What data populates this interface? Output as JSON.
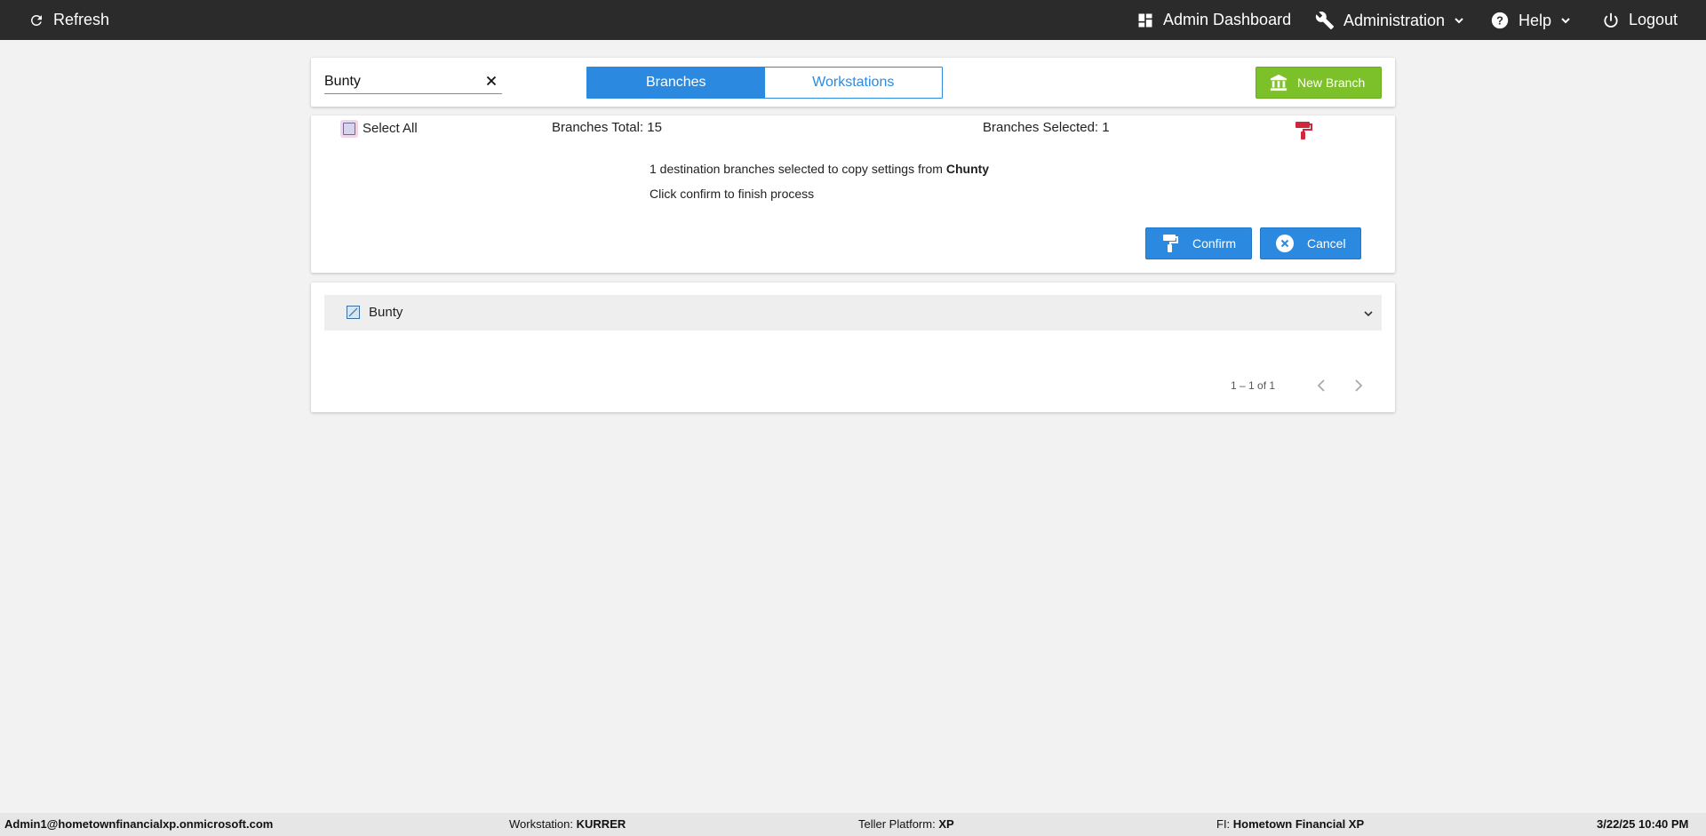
{
  "nav": {
    "refresh_label": "Refresh",
    "admin_dashboard_label": "Admin Dashboard",
    "administration_label": "Administration",
    "help_label": "Help",
    "logout_label": "Logout"
  },
  "search": {
    "value": "Bunty",
    "clear_icon": "close-icon"
  },
  "tabs": [
    {
      "label": "Branches",
      "active": true
    },
    {
      "label": "Workstations",
      "active": false
    }
  ],
  "new_branch_label": "New Branch",
  "copy_panel": {
    "select_all_label": "Select All",
    "branches_total": "Branches Total: 15",
    "branches_selected": "Branches Selected: 1",
    "message_prefix": "1 destination branches selected to copy settings from",
    "source_branch": "Chunty",
    "hint": "Click confirm to finish process",
    "confirm_label": "Confirm",
    "cancel_label": "Cancel"
  },
  "branch_list": {
    "items": [
      {
        "name": "Bunty",
        "checked": true
      }
    ],
    "paginator": "1 – 1 of 1"
  },
  "footer": {
    "user": "Admin1@hometownfinancialxp.onmicrosoft.com",
    "workstation_label": "Workstation:",
    "workstation_value": "KURRER",
    "teller_platform_label": "Teller Platform:",
    "teller_platform_value": "XP",
    "fi_label": "FI:",
    "fi_value": "Hometown Financial XP",
    "datetime": "3/22/25 10:40 PM"
  },
  "colors": {
    "topbar": "#2b2b2b",
    "primary_blue": "#2b8ae0",
    "green": "#7dc12a",
    "red_icon": "#d0283a",
    "background": "#f2f2f2"
  }
}
